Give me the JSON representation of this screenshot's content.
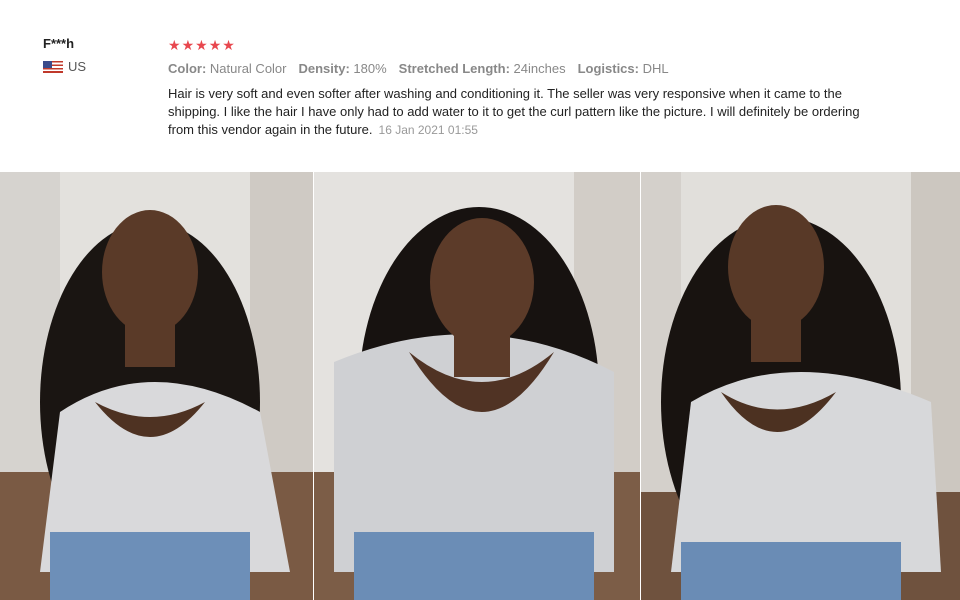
{
  "review": {
    "reviewer_name": "F***h",
    "country": "US",
    "rating": 5,
    "stars": [
      "★",
      "★",
      "★",
      "★",
      "★"
    ],
    "star_color": "#e8474e",
    "specs": [
      {
        "label": "Color:",
        "value": "Natural Color"
      },
      {
        "label": "Density:",
        "value": "180%"
      },
      {
        "label": "Stretched Length:",
        "value": "24inches"
      },
      {
        "label": "Logistics:",
        "value": "DHL"
      }
    ],
    "text": "Hair is very soft and even softer after washing and conditioning it. The seller was very responsive when it came to the shipping. I like the hair I have only had to add water to it to get the curl pattern like the picture. I will definitely be ordering from this vendor again in the future.",
    "date": "16 Jan 2021 01:55"
  },
  "photos": [
    {
      "name": "review-photo-1"
    },
    {
      "name": "review-photo-2"
    },
    {
      "name": "review-photo-3"
    }
  ]
}
